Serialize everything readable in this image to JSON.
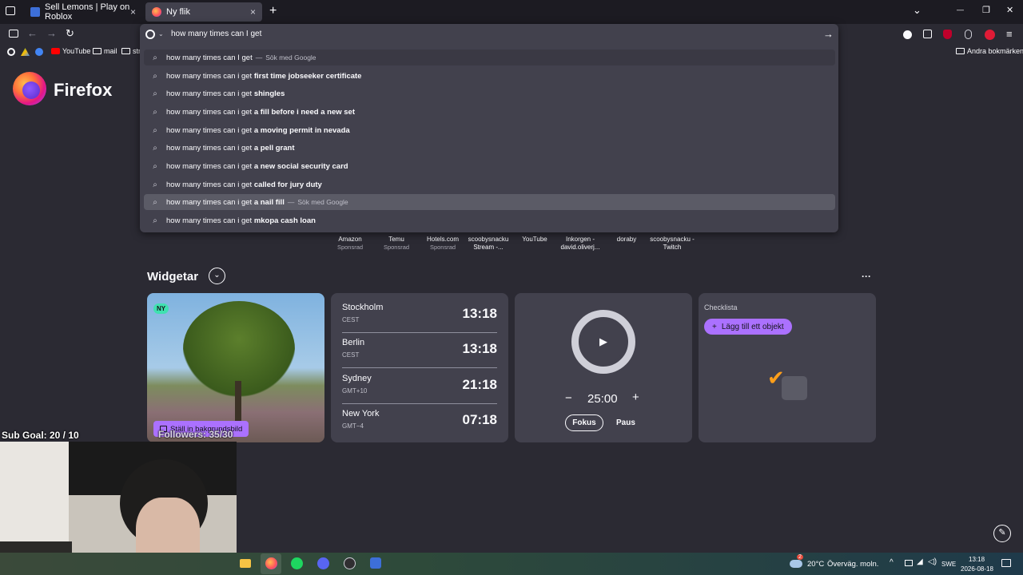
{
  "tabs": [
    {
      "title": "Sell Lemons | Play on Roblox",
      "close": "×"
    },
    {
      "title": "Ny flik",
      "close": "×"
    }
  ],
  "tab_bar": {
    "new_tab": "+",
    "list_tabs": "⌄",
    "minimize": "—",
    "restore": "❐",
    "close": "✕"
  },
  "urlbar": {
    "value": "how many times can I get "
  },
  "suggestions": [
    {
      "prefix": "how many times can I get",
      "bold": "",
      "suffix": "Sök med Google"
    },
    {
      "prefix": "how many times can i get ",
      "bold": "first time jobseeker certificate",
      "suffix": ""
    },
    {
      "prefix": "how many times can i get ",
      "bold": "shingles",
      "suffix": ""
    },
    {
      "prefix": "how many times can i get ",
      "bold": "a fill before i need a new set",
      "suffix": ""
    },
    {
      "prefix": "how many times can i get ",
      "bold": "a moving permit in nevada",
      "suffix": ""
    },
    {
      "prefix": "how many times can i get ",
      "bold": "a pell grant",
      "suffix": ""
    },
    {
      "prefix": "how many times can i get ",
      "bold": "a new social security card",
      "suffix": ""
    },
    {
      "prefix": "how many times can i get ",
      "bold": "called for jury duty",
      "suffix": ""
    },
    {
      "prefix": "how many times can i get ",
      "bold": "a nail fill",
      "suffix": "Sök med Google"
    },
    {
      "prefix": "how many times can i get ",
      "bold": "mkopa cash loan",
      "suffix": ""
    }
  ],
  "bookmarks": {
    "youtube": "YouTube",
    "mail": "mail",
    "str": "str",
    "other": "Andra bokmärken"
  },
  "firefox": {
    "wordmark": "Firefox"
  },
  "shortcuts": [
    {
      "title": "Amazon",
      "sub": "Sponsrad"
    },
    {
      "title": "Temu",
      "sub": "Sponsrad"
    },
    {
      "title": "Hotels.com",
      "sub": "Sponsrad"
    },
    {
      "title": "scoobysnacku Stream -...",
      "sub": ""
    },
    {
      "title": "YouTube",
      "sub": ""
    },
    {
      "title": "Inkorgen - david.oliverj...",
      "sub": ""
    },
    {
      "title": "doraby",
      "sub": ""
    },
    {
      "title": "scoobysnacku - Twitch",
      "sub": ""
    }
  ],
  "widgets": {
    "heading": "Widgetar",
    "more": "···",
    "wallpaper": {
      "badge": "NY",
      "button": "Ställ in bakgrundsbild"
    },
    "clocks": [
      {
        "city": "Stockholm",
        "tz": "CEST",
        "time": "13:18"
      },
      {
        "city": "Berlin",
        "tz": "CEST",
        "time": "13:18"
      },
      {
        "city": "Sydney",
        "tz": "GMT+10",
        "time": "21:18"
      },
      {
        "city": "New York",
        "tz": "GMT−4",
        "time": "07:18"
      }
    ],
    "timer": {
      "minus": "−",
      "value": "25:00",
      "plus": "+",
      "focus": "Fokus",
      "pause": "Paus"
    },
    "checklist": {
      "title": "Checklista",
      "add": "Lägg till ett objekt"
    }
  },
  "overlay": {
    "sub_goal": "Sub Goal: 20 / 10",
    "followers": "Followers: 35/30"
  },
  "taskbar": {
    "weather_badge": "2",
    "temp": "20°C",
    "weather": "Överväg. moln.",
    "lang": "SWE",
    "time": "13:18",
    "date": "2026-08-18"
  },
  "colors": {
    "accent_purple": "#ab71ff",
    "bg": "#2b2a33",
    "panel": "#42414d"
  }
}
